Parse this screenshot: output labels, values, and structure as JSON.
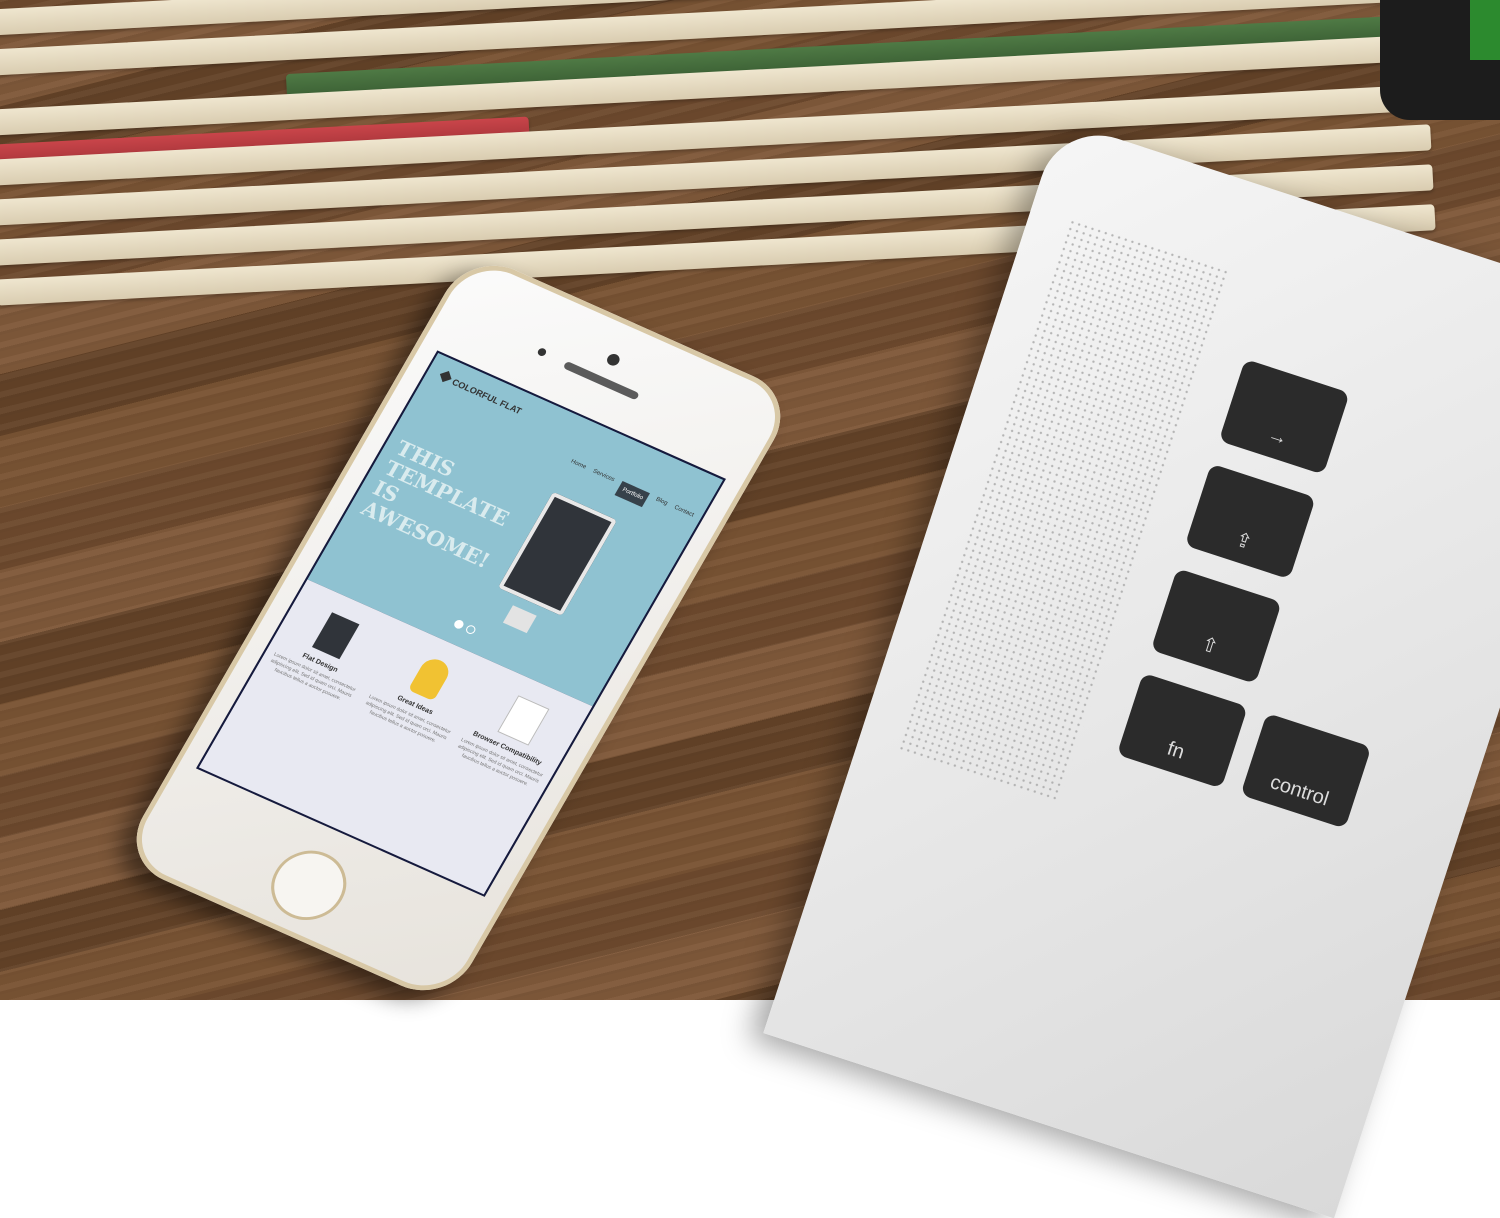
{
  "phone_site": {
    "logo": "COLORFUL FLAT",
    "nav": [
      "Home",
      "Services",
      "Portfolio",
      "Blog",
      "Contact"
    ],
    "nav_active_index": 2,
    "headline": "THIS TEMPLATE IS AWESOME!",
    "slider_dots": 2,
    "features": [
      {
        "title": "Flat Design",
        "desc": "Lorem ipsum dolor sit amet, consectetur adipiscing elit. Sed id quam orci. Mauris faucibus tellus a auctor posuere."
      },
      {
        "title": "Great Ideas",
        "desc": "Lorem ipsum dolor sit amet, consectetur adipiscing elit. Sed id quam orci. Mauris faucibus tellus a auctor posuere."
      },
      {
        "title": "Browser Compatibility",
        "desc": "Lorem ipsum dolor sit amet, consectetur adipiscing elit. Sed id quam orci. Mauris faucibus tellus a auctor posuere."
      }
    ]
  },
  "laptop_keys": [
    "fn",
    "control"
  ],
  "colors": {
    "hero_bg": "#8fc2d1",
    "features_bg": "#e8e9f2",
    "nav_active": "#36414a"
  }
}
